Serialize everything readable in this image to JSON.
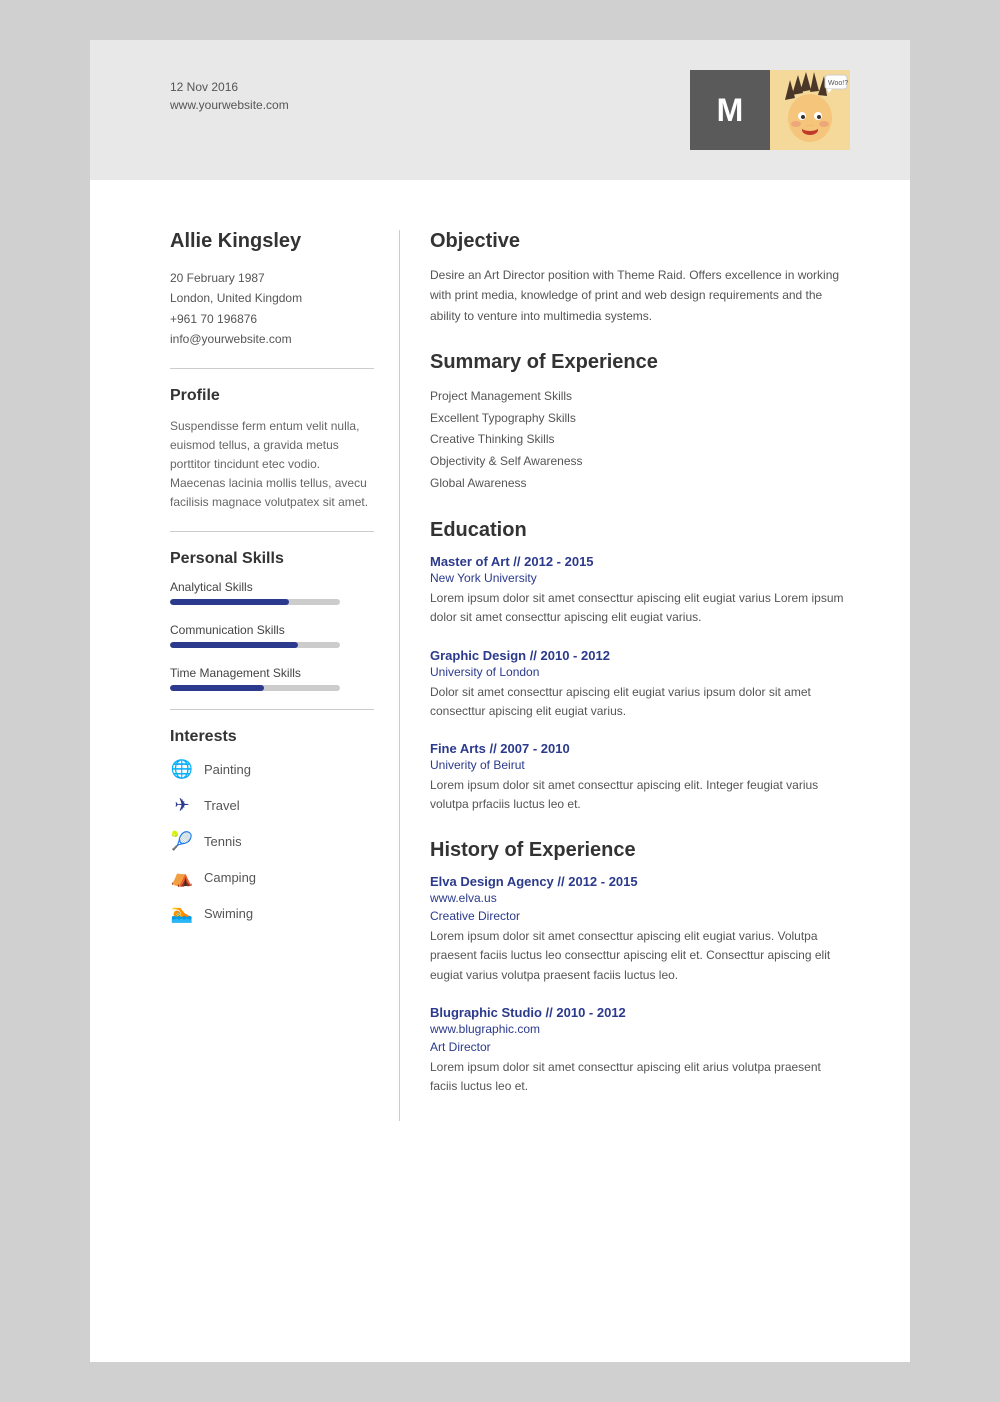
{
  "header": {
    "date": "12 Nov 2016",
    "website": "www.yourwebsite.com",
    "monogram": "M"
  },
  "person": {
    "name": "Allie Kingsley",
    "dob": "20 February 1987",
    "location": "London, United Kingdom",
    "phone": "+961 70 196876",
    "email": "info@yourwebsite.com"
  },
  "profile": {
    "title": "Profile",
    "text": "Suspendisse ferm entum velit nulla, euismod tellus, a gravida metus porttitor tincidunt etec vodio. Maecenas lacinia mollis tellus, avecu facilisis magnace volutpatex sit amet."
  },
  "skills": {
    "title": "Personal Skills",
    "items": [
      {
        "label": "Analytical Skills",
        "percent": 70
      },
      {
        "label": "Communication Skills",
        "percent": 75
      },
      {
        "label": "Time Management Skills",
        "percent": 55
      }
    ]
  },
  "interests": {
    "title": "Interests",
    "items": [
      {
        "label": "Painting",
        "icon": "🌐"
      },
      {
        "label": "Travel",
        "icon": "✈"
      },
      {
        "label": "Tennis",
        "icon": "🎾"
      },
      {
        "label": "Camping",
        "icon": "⛺"
      },
      {
        "label": "Swiming",
        "icon": "🏊"
      }
    ]
  },
  "objective": {
    "title": "Objective",
    "text": "Desire an Art Director position with Theme Raid. Offers excellence in working with print media, knowledge of print and web design requirements and the ability to venture into multimedia systems."
  },
  "summary": {
    "title": "Summary of Experience",
    "items": [
      "Project Management Skills",
      "Excellent Typography Skills",
      "Creative Thinking Skills",
      "Objectivity & Self Awareness",
      "Global Awareness"
    ]
  },
  "education": {
    "title": "Education",
    "entries": [
      {
        "title": "Master of Art // 2012 - 2015",
        "subtitle": "New York University",
        "body": "Lorem ipsum dolor sit amet consecttur apiscing elit eugiat varius Lorem ipsum dolor sit amet consecttur apiscing elit eugiat varius."
      },
      {
        "title": "Graphic Design // 2010 - 2012",
        "subtitle": "University of London",
        "body": "Dolor sit amet consecttur apiscing elit eugiat varius  ipsum dolor sit amet consecttur apiscing elit eugiat varius."
      },
      {
        "title": "Fine Arts // 2007 - 2010",
        "subtitle": "Univerity of Beirut",
        "body": "Lorem ipsum dolor sit amet consecttur apiscing elit. Integer feugiat varius volutpa prfaciis luctus leo et."
      }
    ]
  },
  "experience": {
    "title": "History of Experience",
    "entries": [
      {
        "title": "Elva Design Agency // 2012 - 2015",
        "subtitle": "www.elva.us",
        "role": "Creative Director",
        "body": "Lorem ipsum dolor sit amet consecttur apiscing elit eugiat varius.\nVolutpa praesent faciis luctus leo consecttur apiscing elit et.\nConsecttur apiscing elit eugiat varius volutpa praesent faciis luctus leo."
      },
      {
        "title": "Blugraphic Studio // 2010 - 2012",
        "subtitle": "www.blugraphic.com",
        "role": "Art Director",
        "body": "Lorem ipsum dolor sit amet consecttur apiscing elit arius volutpa praesent faciis luctus leo et."
      }
    ]
  }
}
